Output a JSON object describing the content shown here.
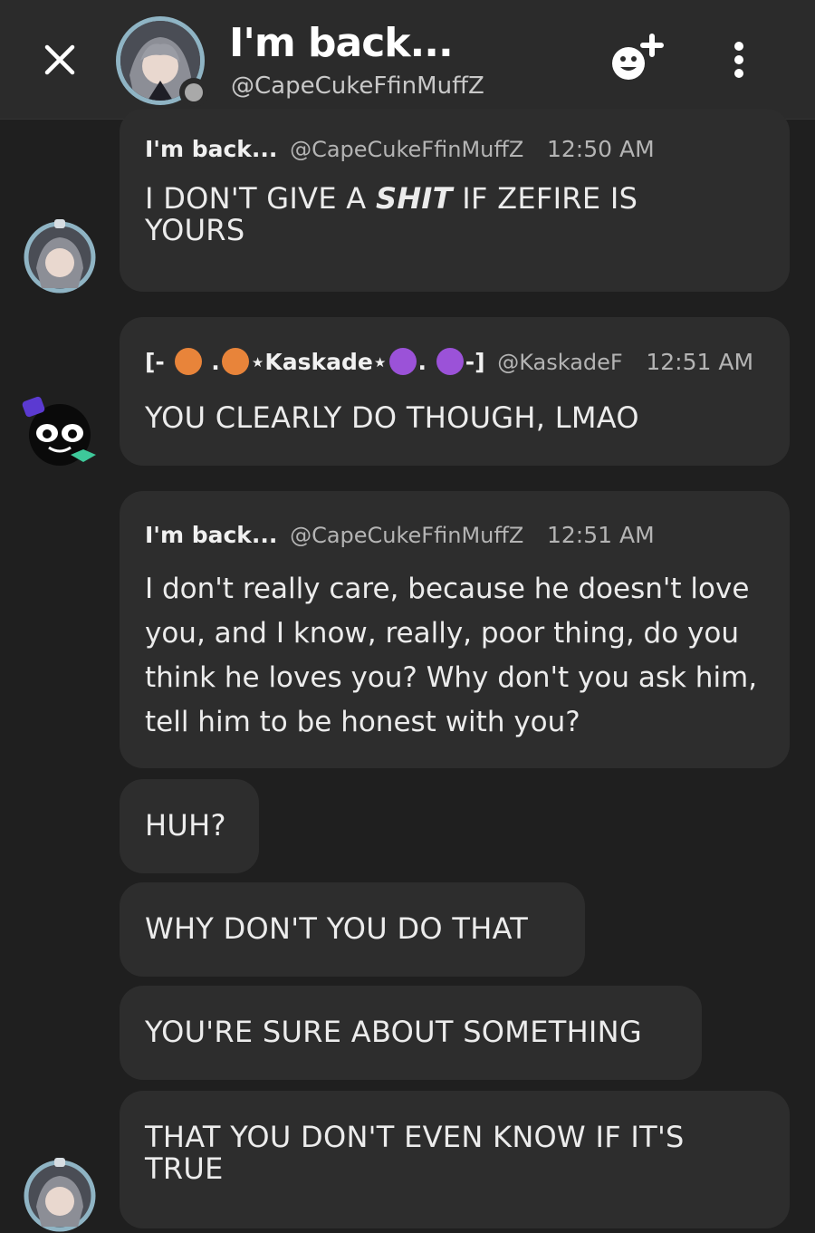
{
  "header": {
    "title": "I'm back...",
    "handle": "@CapeCukeFfinMuffZ"
  },
  "messages": [
    {
      "name": "I'm back...",
      "handle": "@CapeCukeFfinMuffZ",
      "time": "12:50 AM",
      "text_before": "I DON'T GIVE A ",
      "text_bold": "SHIT",
      "text_after": " IF ZEFIRE IS YOURS"
    },
    {
      "name_prefix": "[-",
      "name_mid1": ".",
      "name_core": "⋆Kaskade⋆",
      "name_mid2": ".",
      "name_suffix": "-]",
      "handle": "@KaskadeF",
      "time": "12:51 AM",
      "text": "YOU CLEARLY DO THOUGH, LMAO"
    },
    {
      "name": "I'm back...",
      "handle": "@CapeCukeFfinMuffZ",
      "time": "12:51 AM",
      "text": "I don't really care, because he doesn't love you, and I know, really, poor thing, do you think he loves you? Why don't you ask him, tell him to be honest with you?"
    }
  ],
  "followups": [
    "HUH?",
    "WHY DON'T YOU DO THAT",
    "YOU'RE SURE ABOUT SOMETHING",
    "THAT YOU DON'T EVEN KNOW IF IT'S TRUE"
  ],
  "colors": {
    "background": "#1f1f1f",
    "header": "#2b2b2b",
    "bubble": "#2d2d2d",
    "status_offline": "#a9a9a9"
  }
}
